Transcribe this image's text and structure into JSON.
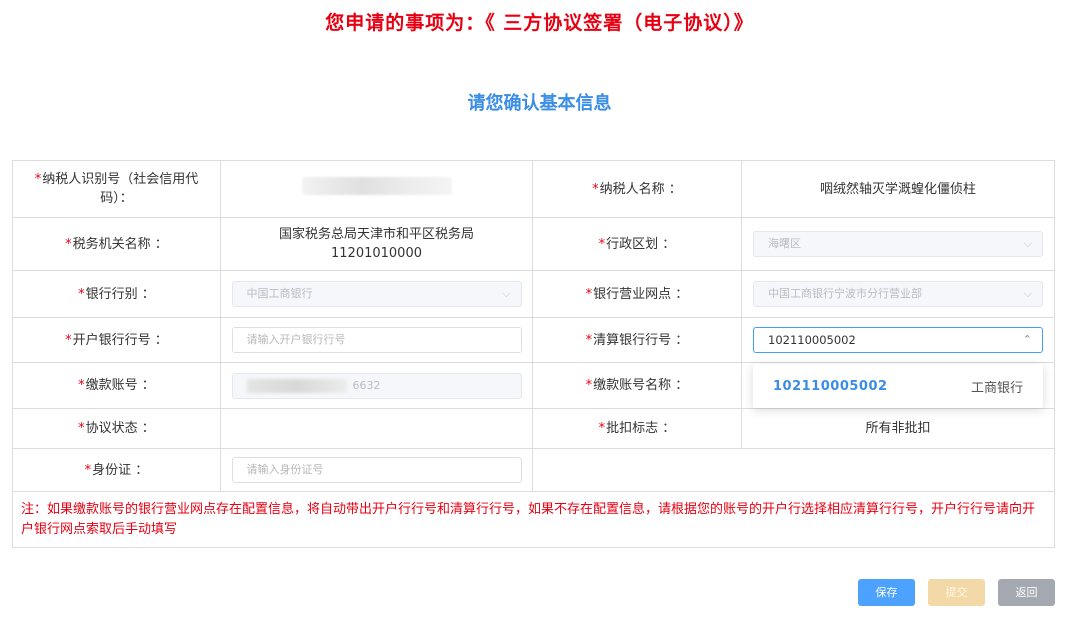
{
  "header": {
    "title": "您申请的事项为：《 三方协议签署（电子协议）》",
    "section_title": "请您确认基本信息"
  },
  "form": {
    "taxpayer_id_label": "纳税人识别号（社会信用代码）：",
    "taxpayer_name_label": "纳税人名称 ：",
    "taxpayer_name_value": "咽绒然轴灭学溉蝗化僵侦柱",
    "tax_office_label": "税务机关名称 ：",
    "tax_office_value_line1": "国家税务总局天津市和平区税务局",
    "tax_office_value_line2": "11201010000",
    "district_label": "行政区划 ：",
    "district_value": "海曙区",
    "bank_type_label": "银行行别 ：",
    "bank_type_value": "中国工商银行",
    "bank_branch_label": "银行营业网点 ：",
    "bank_branch_value": "中国工商银行宁波市分行营业部",
    "open_bank_no_label": "开户银行行号 ：",
    "open_bank_no_placeholder": "请输入开户银行行号",
    "clearing_bank_no_label": "清算银行行号 ：",
    "clearing_bank_no_value": "102110005002",
    "account_label": "缴款账号 ：",
    "account_value_suffix": "6632",
    "account_name_label": "缴款账号名称 ：",
    "agreement_status_label": "协议状态 ：",
    "batch_flag_label": "批扣标志 ：",
    "batch_flag_value": "所有非批扣",
    "id_card_label": "身份证 ：",
    "id_card_placeholder": "请输入身份证号",
    "required_mark": "*",
    "chevron_down": "⌵",
    "chevron_up": "⌃",
    "note": "注：如果缴款账号的银行营业网点存在配置信息，将自动带出开户行行号和清算行行号，如果不存在配置信息，请根据您的账号的开户行选择相应清算行行号，开户行行号请向开户银行网点索取后手动填写"
  },
  "dropdown": {
    "option_code": "102110005002",
    "option_bank": "工商银行"
  },
  "buttons": {
    "save": "保存",
    "submit": "提交",
    "back": "返回"
  },
  "colors": {
    "title_red": "#e60012",
    "section_blue": "#3a8ee6",
    "save_blue": "#4da2ff",
    "submit_disabled": "#f4d9a8",
    "back_gray": "#a4a8b0"
  }
}
